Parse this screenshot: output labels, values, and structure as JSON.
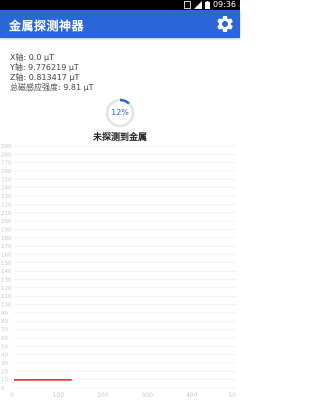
{
  "status_bar": {
    "time": "09:36"
  },
  "app_bar": {
    "title": "金属探测神器",
    "settings_icon": "gear-icon"
  },
  "readings": {
    "x": "X轴:  0.0 μT",
    "y": "Y轴:  9.776219 μT",
    "z": "Z轴:  0.813417 μT",
    "total": "总磁感应强度:  9.81 μT"
  },
  "progress": {
    "value": 0.12,
    "label": "12%"
  },
  "status_message": "未探测到金属",
  "colors": {
    "accent": "#2a66d8",
    "line": "#d81b1b",
    "grid": "#e6e6e6",
    "tick": "#c8c8c8"
  },
  "chart_data": {
    "type": "line",
    "ylim": [
      0,
      290
    ],
    "xlim": [
      0,
      500
    ],
    "y_ticks": [
      "0",
      "10",
      "20",
      "30",
      "40",
      "50",
      "60",
      "70",
      "80",
      "90",
      "100",
      "110",
      "120",
      "130",
      "140",
      "150",
      "160",
      "170",
      "180",
      "190",
      "200",
      "210",
      "220",
      "230",
      "240",
      "250",
      "260",
      "270",
      "280",
      "290"
    ],
    "x_ticks": [
      "0",
      "100",
      "200",
      "300",
      "400",
      "50"
    ],
    "series": [
      {
        "x": [
          0,
          130
        ],
        "y": [
          9.81,
          9.81
        ]
      }
    ]
  }
}
